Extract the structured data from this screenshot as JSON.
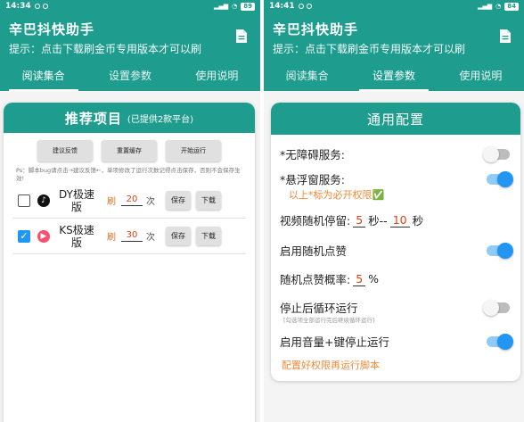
{
  "left": {
    "status": {
      "time": "14:34",
      "battery": "89"
    },
    "appbar": {
      "title": "辛巴抖快助手",
      "subtitle": "提示：点击下载刷金币专用版本才可以刷"
    },
    "tabs": [
      "阅读集合",
      "设置参数",
      "使用说明"
    ],
    "card": {
      "title": "推荐项目",
      "subtitle": "(已提供2款平台)",
      "buttons": {
        "feedback": "建议反馈",
        "reset": "重置缓存",
        "start": "开始运行"
      },
      "hint": "Ps：脚本bug请点击→建议反馈←，单项修改了运行次数记得点击保存，否则不会保存生效!",
      "platforms": [
        {
          "name": "DY极速版",
          "checked": false,
          "brush_label": "刷",
          "count": "20",
          "unit": "次",
          "save": "保存",
          "download": "下载"
        },
        {
          "name": "KS极速版",
          "checked": true,
          "brush_label": "刷",
          "count": "30",
          "unit": "次",
          "save": "保存",
          "download": "下载"
        }
      ]
    }
  },
  "right": {
    "status": {
      "time": "14:41",
      "battery": "84"
    },
    "appbar": {
      "title": "辛巴抖快助手",
      "subtitle": "提示：点击下载刷金币专用版本才可以刷"
    },
    "tabs": [
      "阅读集合",
      "设置参数",
      "使用说明"
    ],
    "card": {
      "title": "通用配置",
      "accessibility": "*无障碍服务:",
      "floating": "*悬浮窗服务:",
      "permission_note": "以上*标为必开权限✅",
      "video_pause_label": "视频随机停留:",
      "video_pause_min": "5",
      "video_pause_mid": "秒--",
      "video_pause_max": "10",
      "video_pause_unit": "秒",
      "random_like": "启用随机点赞",
      "like_prob_label": "随机点赞概率:",
      "like_prob_value": "5",
      "like_prob_unit": "%",
      "loop_label": "停止后循环运行",
      "loop_note": "[勾选项全部运行完后继续循环运行]",
      "volume_stop": "启用音量+键停止运行",
      "footer": "配置好权限再运行脚本",
      "toggles": {
        "accessibility": false,
        "floating": true,
        "random_like": true,
        "loop": false,
        "volume_stop": true
      }
    }
  }
}
